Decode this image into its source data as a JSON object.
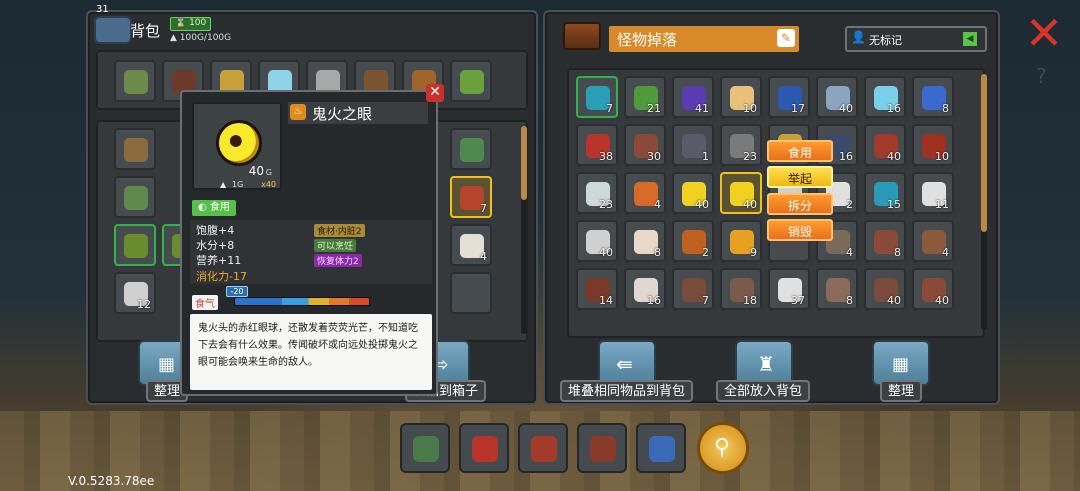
{
  "version": "V.0.5283.78ee",
  "bag": {
    "title": "背包",
    "slot_count": "31",
    "capacity_badge": "100",
    "weight": "100G/100G",
    "row1_icons": [
      "item-1",
      "item-2",
      "item-3",
      "item-4",
      "item-5",
      "item-6",
      "item-7",
      "item-8"
    ],
    "left_counts": {
      "c7": "7",
      "c4": "4",
      "c12": "12"
    },
    "buttons": {
      "sort": "整理",
      "move_to_box": "物品到箱子"
    }
  },
  "tooltip": {
    "name": "鬼火之眼",
    "weight_value": "40",
    "weight_unit": "G",
    "item_weight": "1G",
    "quantity": "x40",
    "tag": "食用",
    "stats": [
      "饱腹+4",
      "水分+8",
      "营养+11"
    ],
    "digest": "消化力-17",
    "attrs": [
      "食材·内脏2",
      "可以烹饪",
      "恢复体力2"
    ],
    "bar_label": "食气",
    "bar_value": "-20",
    "description": "鬼火头的赤红眼球，还散发着荧荧光芒，不知道吃下去会有什么效果。传闻破坏或向远处投掷鬼火之眼可能会唤来生命的敌人。"
  },
  "loot": {
    "title": "怪物掉落",
    "tag_label": "无标记",
    "counts": [
      [
        "7",
        "21",
        "41",
        "10",
        "17",
        "40",
        "16",
        "8"
      ],
      [
        "38",
        "30",
        "1",
        "23",
        "",
        "16",
        "40",
        "10"
      ],
      [
        "23",
        "4",
        "40",
        "40",
        "",
        "2",
        "15",
        "11"
      ],
      [
        "40",
        "8",
        "2",
        "9",
        "",
        "4",
        "8",
        "4"
      ],
      [
        "14",
        "16",
        "7",
        "18",
        "37",
        "8",
        "40",
        "40"
      ]
    ],
    "context_menu": [
      "食用",
      "举起",
      "拆分",
      "销毁"
    ],
    "buttons": {
      "stack": "堆叠相同物品到背包",
      "all_to_bag": "全部放入背包",
      "sort": "整理"
    }
  },
  "colors": {
    "accent_orange": "#e9701b",
    "title_orange": "#d8892a",
    "close_red": "#d9342b",
    "selected_yellow": "#f1c21b",
    "tag_green": "#56c04a",
    "purple_tag": "#8a2aa8"
  }
}
